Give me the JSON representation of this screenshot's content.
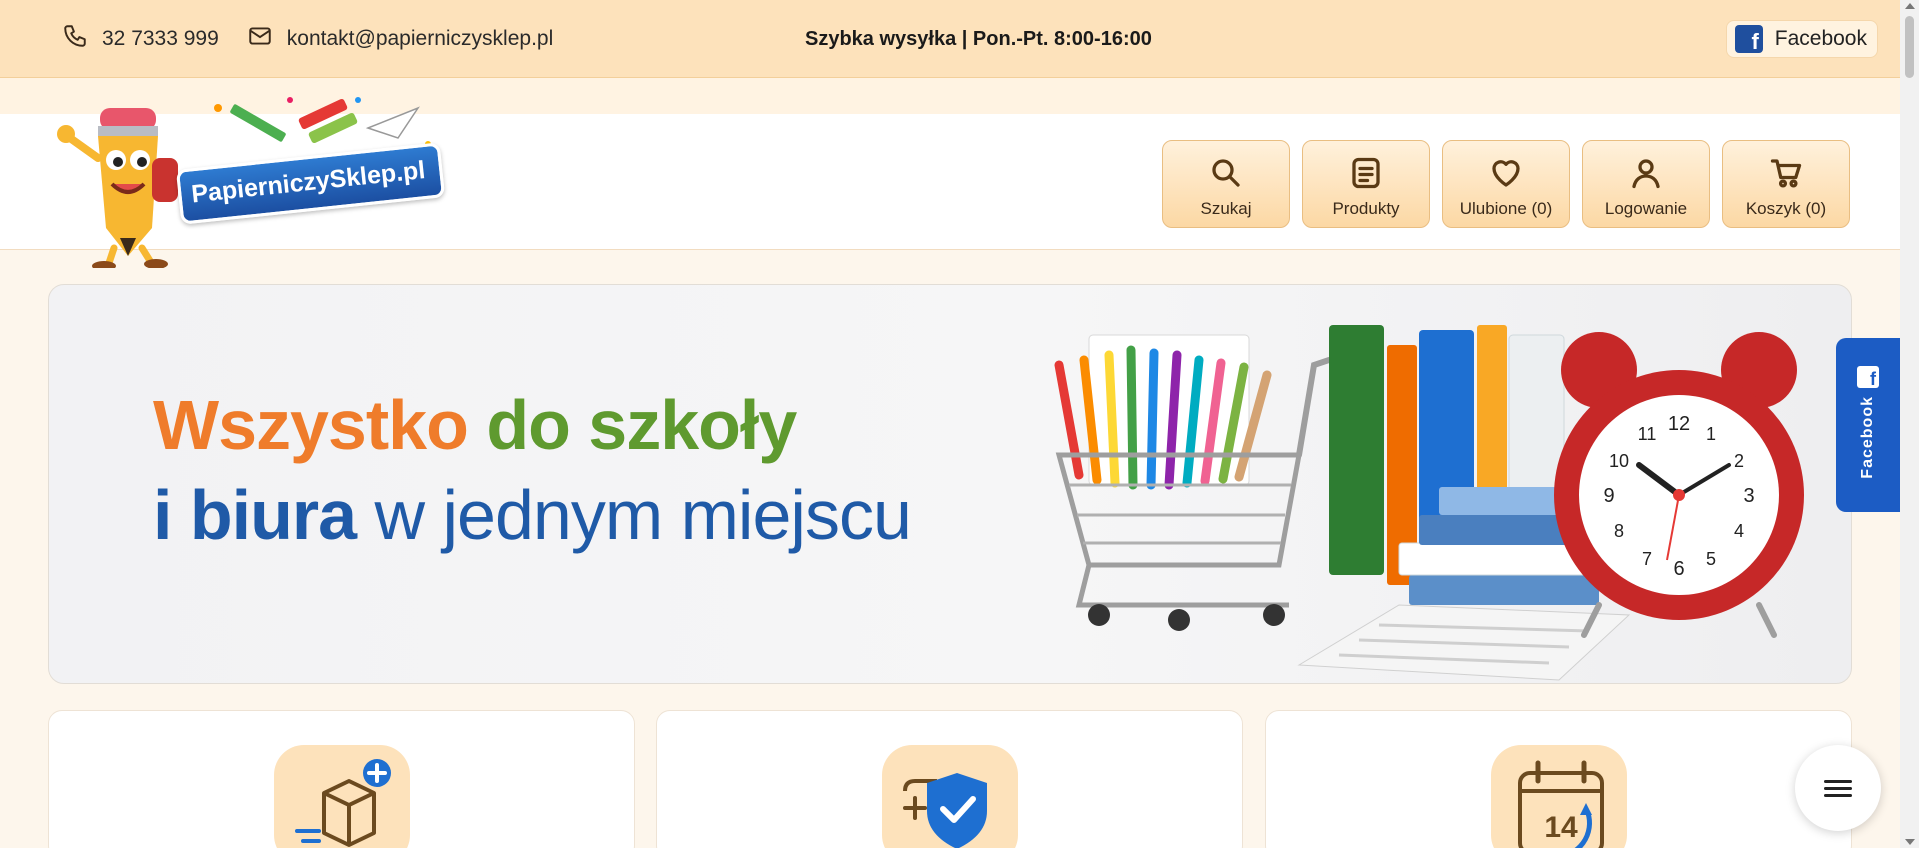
{
  "topbar": {
    "phone": "32 7333 999",
    "email": "kontakt@papierniczysklep.pl",
    "shipping": "Szybka wysyłka | Pon.-Pt. 8:00-16:00",
    "facebook_label": "Facebook",
    "icons": [
      "phone-icon",
      "mail-icon",
      "facebook-icon"
    ]
  },
  "logo": {
    "text": "PapierniczySklep.pl"
  },
  "nav": [
    {
      "label": "Szukaj",
      "icon": "search-icon"
    },
    {
      "label": "Produkty",
      "icon": "list-icon"
    },
    {
      "label": "Ulubione (0)",
      "icon": "heart-icon"
    },
    {
      "label": "Logowanie",
      "icon": "user-icon"
    },
    {
      "label": "Koszyk (0)",
      "icon": "cart-icon"
    }
  ],
  "hero": {
    "line1_word1": "Wszystko",
    "line1_word2": "do szkoły",
    "line2_word1": "i biura",
    "line2_word2": "w jednym miejscu",
    "clock_numbers": [
      "12",
      "1",
      "2",
      "3",
      "4",
      "5",
      "6",
      "7",
      "8",
      "9",
      "10",
      "11"
    ]
  },
  "side_tab": {
    "label": "Facebook"
  },
  "feature_cards": [
    {
      "icon": "package-plus-icon"
    },
    {
      "icon": "shield-check-icon"
    },
    {
      "icon": "calendar-return-icon",
      "number": "14"
    }
  ],
  "colors": {
    "topbar": "#fde2bb",
    "accent_orange": "#ef7c2b",
    "accent_green": "#5f9a2f",
    "accent_blue": "#1f5aa7",
    "facebook_blue": "#1c5cc4"
  }
}
